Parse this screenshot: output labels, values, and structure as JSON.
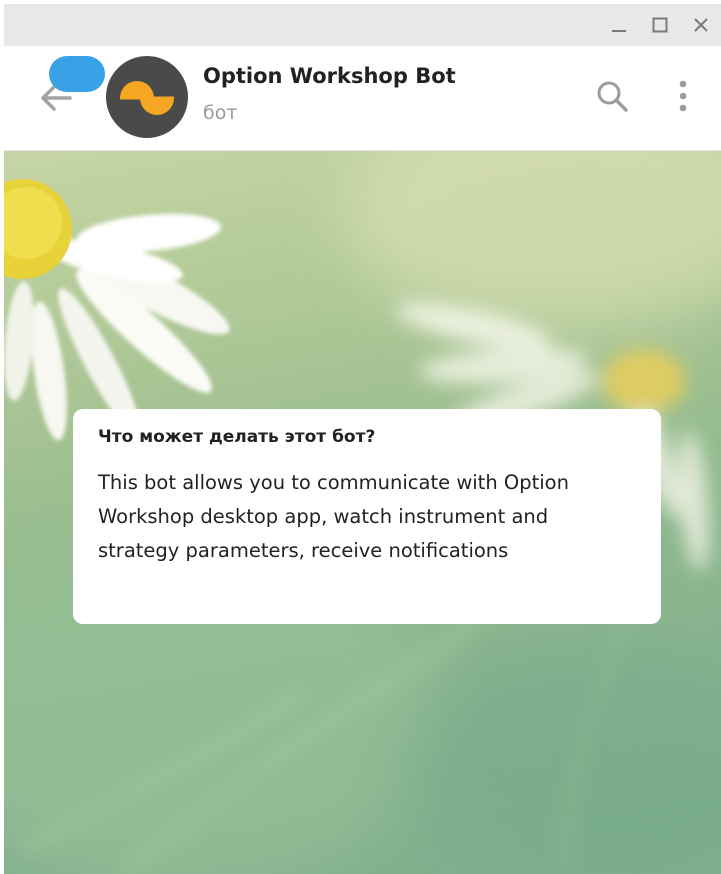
{
  "window": {
    "controls": {
      "minimize_icon": "minimize-icon",
      "maximize_icon": "maximize-icon",
      "close_icon": "close-icon"
    }
  },
  "header": {
    "title": "Option Workshop Bot",
    "subtitle": "бот",
    "accent_color": "#39a1e6",
    "avatar_colors": {
      "background": "#4a4a4a",
      "shape": "#f5a623"
    }
  },
  "bot_info": {
    "title": "Что может делать этот бот?",
    "description": "This bot allows you to communicate with Option Workshop desktop app, watch instrument and strategy parameters, receive notifications"
  }
}
